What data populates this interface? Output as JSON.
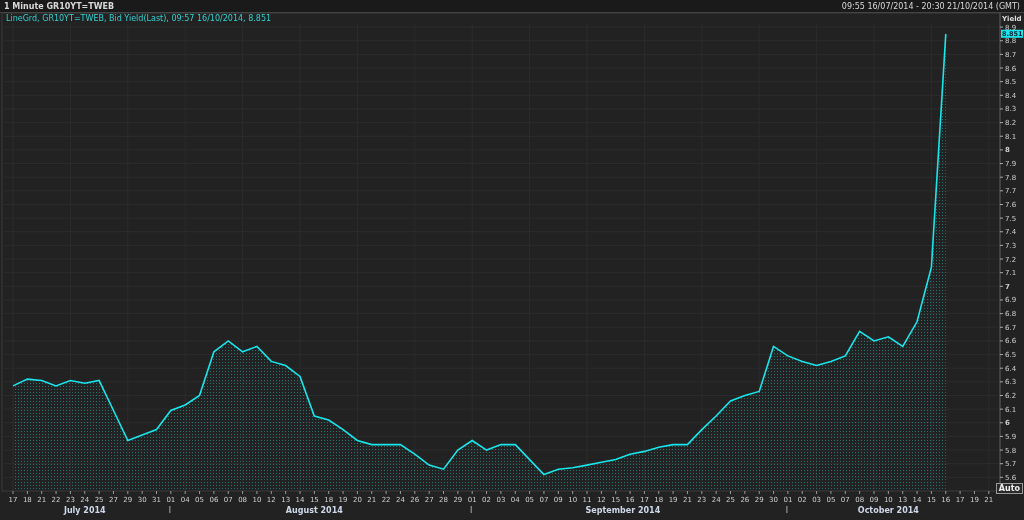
{
  "header": {
    "title": "1 Minute GR10YT=TWEB",
    "range": "09:55 16/07/2014 - 20:30 21/10/2014 (GMT)"
  },
  "legend": "LineGrd, GR10YT=TWEB, Bid Yield(Last), 09:57 16/10/2014, 8.851",
  "last_value_tag": "8.851",
  "auto_button": "Auto",
  "months": [
    "July 2014",
    "August 2014",
    "September 2014",
    "October 2014"
  ],
  "chart_data": {
    "type": "area",
    "ylabel": "Yield",
    "ylim": [
      5.5,
      8.93
    ],
    "grid": true,
    "yticks": [
      5.6,
      5.7,
      5.8,
      5.9,
      6,
      6.1,
      6.2,
      6.3,
      6.4,
      6.5,
      6.6,
      6.7,
      6.8,
      6.9,
      7,
      7.1,
      7.2,
      7.3,
      7.4,
      7.5,
      7.6,
      7.7,
      7.8,
      7.9,
      8,
      8.1,
      8.2,
      8.3,
      8.4,
      8.5,
      8.6,
      8.7,
      8.8,
      8.9
    ],
    "categories": [
      "17",
      "18",
      "21",
      "22",
      "23",
      "24",
      "25",
      "27",
      "29",
      "30",
      "31",
      "01",
      "04",
      "05",
      "06",
      "07",
      "08",
      "10",
      "12",
      "13",
      "14",
      "15",
      "18",
      "19",
      "20",
      "21",
      "22",
      "24",
      "26",
      "27",
      "28",
      "29",
      "01",
      "02",
      "03",
      "04",
      "05",
      "07",
      "09",
      "10",
      "11",
      "12",
      "15",
      "16",
      "17",
      "18",
      "19",
      "21",
      "23",
      "24",
      "25",
      "26",
      "29",
      "30",
      "01",
      "02",
      "03",
      "05",
      "07",
      "08",
      "09",
      "10",
      "13",
      "14",
      "15",
      "16",
      "17",
      "19",
      "21"
    ],
    "series": [
      {
        "color": "#19e6ec",
        "values": [
          6.27,
          6.32,
          6.31,
          6.27,
          6.31,
          6.29,
          6.31,
          6.09,
          5.87,
          5.91,
          5.95,
          6.09,
          6.13,
          6.2,
          6.52,
          6.6,
          6.52,
          6.56,
          6.45,
          6.42,
          6.34,
          6.05,
          6.02,
          5.95,
          5.87,
          5.84,
          5.84,
          5.84,
          5.77,
          5.69,
          5.66,
          5.8,
          5.87,
          5.8,
          5.84,
          5.84,
          5.73,
          5.62,
          5.66,
          5.67,
          5.69,
          5.71,
          5.73,
          5.77,
          5.79,
          5.82,
          5.84,
          5.84,
          5.95,
          6.05,
          6.16,
          6.2,
          6.23,
          6.56,
          6.49,
          6.45,
          6.42,
          6.45,
          6.49,
          6.67,
          6.6,
          6.63,
          6.56,
          6.74,
          7.14,
          8.85,
          null,
          null,
          null
        ]
      }
    ]
  }
}
